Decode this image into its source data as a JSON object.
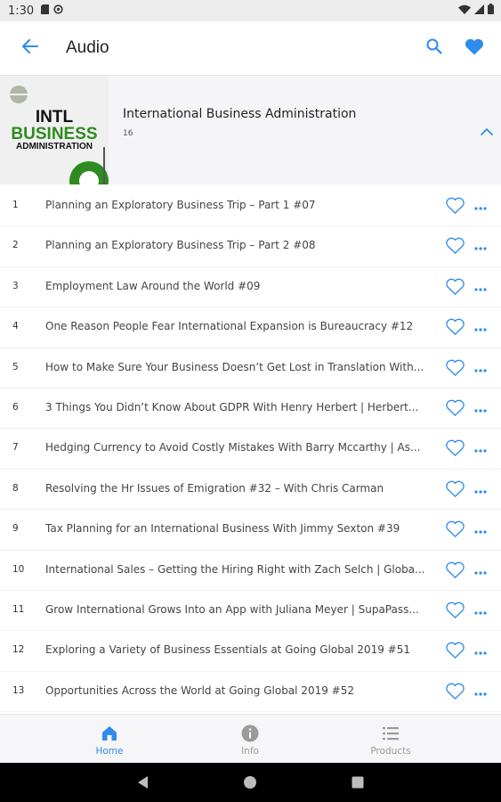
{
  "status_bar": {
    "time": "1:30"
  },
  "app_bar": {
    "title": "Audio",
    "back_icon": "arrow-left-icon",
    "search_icon": "search-icon",
    "favorite_icon": "heart-filled-icon"
  },
  "album": {
    "title": "International Business Administration",
    "count": "16",
    "cover": {
      "line1": "INTL",
      "line2": "BUSINESS",
      "line3": "ADMINISTRATION"
    }
  },
  "tracks": [
    {
      "num": "1",
      "title": "Planning an Exploratory Business Trip – Part 1 #07"
    },
    {
      "num": "2",
      "title": "Planning an Exploratory Business Trip – Part 2 #08"
    },
    {
      "num": "3",
      "title": "Employment Law Around the World #09"
    },
    {
      "num": "4",
      "title": "One Reason People Fear International Expansion is Bureaucracy #12"
    },
    {
      "num": "5",
      "title": "How to Make Sure Your Business Doesn’t Get Lost in Translation With..."
    },
    {
      "num": "6",
      "title": "3 Things You Didn’t Know About GDPR With Henry Herbert | Herbert..."
    },
    {
      "num": "7",
      "title": "Hedging Currency to Avoid Costly Mistakes With Barry Mccarthy | As..."
    },
    {
      "num": "8",
      "title": "Resolving the Hr Issues of Emigration #32 – With Chris Carman"
    },
    {
      "num": "9",
      "title": "Tax Planning for an International Business With Jimmy Sexton #39"
    },
    {
      "num": "10",
      "title": "International Sales – Getting the Hiring Right with Zach Selch | Globa..."
    },
    {
      "num": "11",
      "title": "Grow International Grows Into an App with Juliana Meyer | SupaPass..."
    },
    {
      "num": "12",
      "title": "Exploring a Variety of Business Essentials at Going Global 2019 #51"
    },
    {
      "num": "13",
      "title": "Opportunities Across the World at Going Global 2019 #52"
    }
  ],
  "bottom_nav": [
    {
      "label": "Home",
      "icon": "home-icon",
      "active": true
    },
    {
      "label": "Info",
      "icon": "info-icon",
      "active": false
    },
    {
      "label": "Products",
      "icon": "list-icon",
      "active": false
    }
  ],
  "colors": {
    "accent": "#2f8cea",
    "inactive": "#9a9a9a",
    "cover_green": "#2e8b1f"
  }
}
